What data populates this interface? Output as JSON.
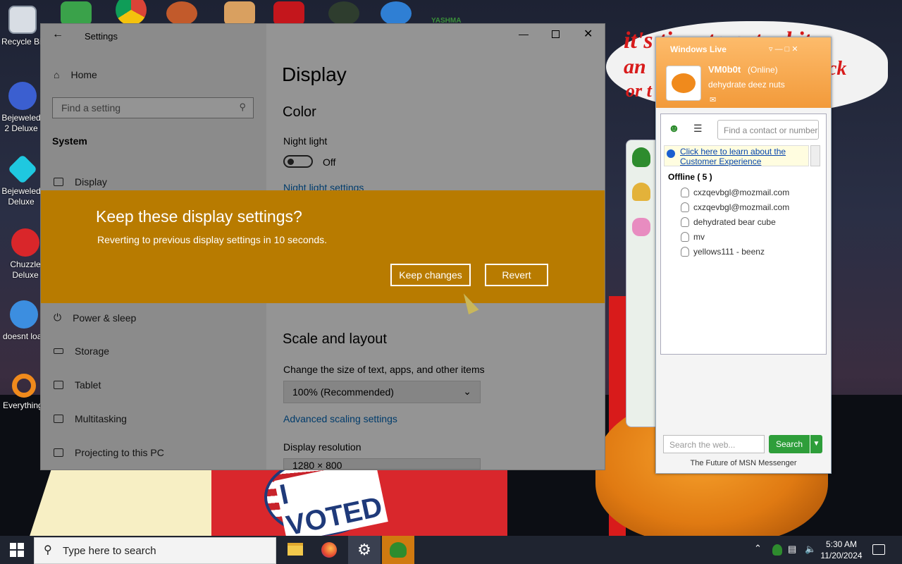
{
  "desktop": {
    "icons": [
      {
        "label": "Recycle Bin",
        "icon": "recycle-bin-icon"
      },
      {
        "label": "Bejeweled 2 Deluxe",
        "icon": "bejeweled-2-icon"
      },
      {
        "label": "Bejeweled Deluxe",
        "icon": "bejeweled-icon"
      },
      {
        "label": "Chuzzle Deluxe",
        "icon": "chuzzle-icon"
      },
      {
        "label": "doesnt load",
        "icon": "thunderbird-icon"
      },
      {
        "label": "Everything",
        "icon": "everything-icon"
      }
    ],
    "wallpaper_text": "it's time to get a bit",
    "wallpaper_text_2": "an",
    "wallpaper_text_3": "or t",
    "wallpaper_text_4": "ck",
    "wallpaper_badge": "I VOTED",
    "top_icon_label": "YASHMA"
  },
  "settings": {
    "title": "Settings",
    "home_label": "Home",
    "search_placeholder": "Find a setting",
    "section_label": "System",
    "nav_items": [
      "Display",
      "Power & sleep",
      "Storage",
      "Tablet",
      "Multitasking",
      "Projecting to this PC"
    ],
    "page_title": "Display",
    "color_heading": "Color",
    "night_light_label": "Night light",
    "night_light_state": "Off",
    "night_light_settings_link": "Night light settings",
    "scale_heading": "Scale and layout",
    "scale_label": "Change the size of text, apps, and other items",
    "scale_value": "100% (Recommended)",
    "advanced_scaling_link": "Advanced scaling settings",
    "resolution_label": "Display resolution",
    "resolution_value": "1280 × 800"
  },
  "dialog": {
    "title": "Keep these display settings?",
    "message": "Reverting to previous display settings in 10 seconds.",
    "keep_button": "Keep changes",
    "revert_button": "Revert",
    "color": "#b87b00"
  },
  "msn": {
    "brand": "Windows Live",
    "username": "VM0b0t",
    "status": "(Online)",
    "personal_message": "dehydrate deez nuts",
    "search_contact_placeholder": "Find a contact or number",
    "info_link": "Click here to learn about the Customer Experience",
    "group_label": "Offline ( 5 )",
    "contacts": [
      "cxzqevbgl@mozmail.com",
      "cxzqevbgl@mozmail.com",
      "dehydrated bear cube",
      "mv",
      "yellows111 - beenz"
    ],
    "web_search_placeholder": "Search the web...",
    "search_button": "Search",
    "footer": "The Future of MSN Messenger",
    "accent": "#f29a3a",
    "search_color": "#2e9e3a"
  },
  "taskbar": {
    "search_placeholder": "Type here to search",
    "time": "5:30 AM",
    "date": "11/20/2024",
    "apps": [
      "file-explorer-icon",
      "firefox-icon",
      "settings-gear-icon",
      "msn-messenger-icon"
    ]
  }
}
